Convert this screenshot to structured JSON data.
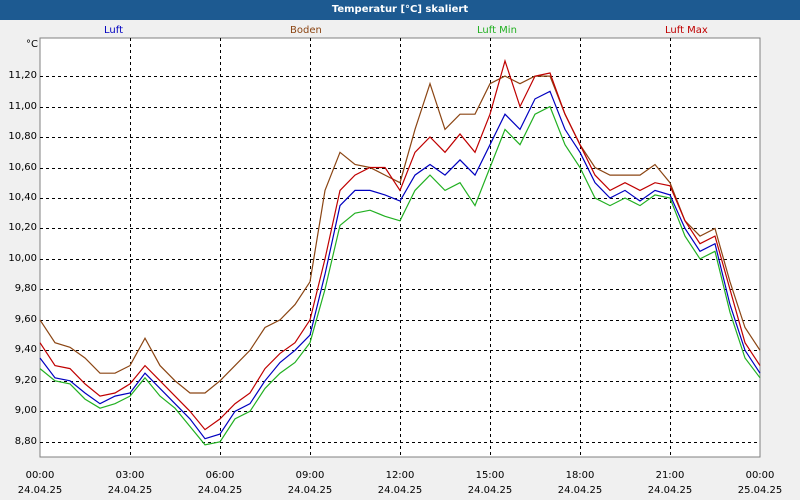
{
  "window": {
    "title": "Temperatur [°C] skaliert"
  },
  "colors": {
    "titlebar": "#1d5a91",
    "plot_bg": "#ffffff",
    "grid": "#000000"
  },
  "chart_data": {
    "type": "line",
    "title": "Temperatur [°C] skaliert",
    "ylabel": "°C",
    "ylim": [
      8.7,
      11.45
    ],
    "xlim": [
      0,
      24
    ],
    "grid": true,
    "legend_position": "top",
    "y_ticks": [
      "8,80",
      "9,00",
      "9,20",
      "9,40",
      "9,60",
      "9,80",
      "10,00",
      "10,20",
      "10,40",
      "10,60",
      "10,80",
      "11,00",
      "11,20"
    ],
    "y_tick_values": [
      8.8,
      9.0,
      9.2,
      9.4,
      9.6,
      9.8,
      10.0,
      10.2,
      10.4,
      10.6,
      10.8,
      11.0,
      11.2
    ],
    "x_ticks": [
      {
        "time": "00:00",
        "date": "24.04.25",
        "hour": 0
      },
      {
        "time": "03:00",
        "date": "24.04.25",
        "hour": 3
      },
      {
        "time": "06:00",
        "date": "24.04.25",
        "hour": 6
      },
      {
        "time": "09:00",
        "date": "24.04.25",
        "hour": 9
      },
      {
        "time": "12:00",
        "date": "24.04.25",
        "hour": 12
      },
      {
        "time": "15:00",
        "date": "24.04.25",
        "hour": 15
      },
      {
        "time": "18:00",
        "date": "24.04.25",
        "hour": 18
      },
      {
        "time": "21:00",
        "date": "24.04.25",
        "hour": 21
      },
      {
        "time": "00:00",
        "date": "25.04.25",
        "hour": 24
      }
    ],
    "x": [
      0,
      0.5,
      1,
      1.5,
      2,
      2.5,
      3,
      3.5,
      4,
      4.5,
      5,
      5.5,
      6,
      6.5,
      7,
      7.5,
      8,
      8.5,
      9,
      9.5,
      10,
      10.5,
      11,
      11.5,
      12,
      12.5,
      13,
      13.5,
      14,
      14.5,
      15,
      15.5,
      16,
      16.5,
      17,
      17.5,
      18,
      18.5,
      19,
      19.5,
      20,
      20.5,
      21,
      21.5,
      22,
      22.5,
      23,
      23.5,
      24
    ],
    "series": [
      {
        "name": "Luft",
        "color": "#0000c0",
        "values": [
          9.35,
          9.22,
          9.2,
          9.12,
          9.05,
          9.1,
          9.12,
          9.25,
          9.15,
          9.05,
          8.95,
          8.82,
          8.85,
          9.0,
          9.05,
          9.2,
          9.32,
          9.4,
          9.5,
          9.9,
          10.35,
          10.45,
          10.45,
          10.42,
          10.38,
          10.55,
          10.62,
          10.55,
          10.65,
          10.55,
          10.75,
          10.95,
          10.85,
          11.05,
          11.1,
          10.85,
          10.7,
          10.5,
          10.4,
          10.45,
          10.38,
          10.45,
          10.42,
          10.2,
          10.05,
          10.1,
          9.7,
          9.4,
          9.25
        ]
      },
      {
        "name": "Boden",
        "color": "#8b4513",
        "values": [
          9.6,
          9.45,
          9.42,
          9.35,
          9.25,
          9.25,
          9.3,
          9.48,
          9.3,
          9.2,
          9.12,
          9.12,
          9.2,
          9.3,
          9.4,
          9.55,
          9.6,
          9.7,
          9.85,
          10.45,
          10.7,
          10.62,
          10.6,
          10.55,
          10.5,
          10.85,
          11.15,
          10.85,
          10.95,
          10.95,
          11.15,
          11.2,
          11.15,
          11.2,
          11.2,
          10.95,
          10.75,
          10.6,
          10.55,
          10.55,
          10.55,
          10.62,
          10.5,
          10.25,
          10.15,
          10.2,
          9.85,
          9.55,
          9.4
        ]
      },
      {
        "name": "Luft Min",
        "color": "#22b022",
        "values": [
          9.28,
          9.2,
          9.18,
          9.08,
          9.02,
          9.05,
          9.1,
          9.22,
          9.1,
          9.02,
          8.9,
          8.78,
          8.8,
          8.95,
          9.0,
          9.15,
          9.25,
          9.32,
          9.45,
          9.8,
          10.22,
          10.3,
          10.32,
          10.28,
          10.25,
          10.45,
          10.55,
          10.45,
          10.5,
          10.35,
          10.6,
          10.85,
          10.75,
          10.95,
          11.0,
          10.75,
          10.6,
          10.4,
          10.35,
          10.4,
          10.35,
          10.42,
          10.4,
          10.15,
          10.0,
          10.05,
          9.65,
          9.35,
          9.22
        ]
      },
      {
        "name": "Luft Max",
        "color": "#c00000",
        "values": [
          9.45,
          9.3,
          9.28,
          9.18,
          9.1,
          9.12,
          9.18,
          9.3,
          9.2,
          9.1,
          9.0,
          8.88,
          8.95,
          9.05,
          9.12,
          9.28,
          9.38,
          9.45,
          9.6,
          10.0,
          10.45,
          10.55,
          10.6,
          10.6,
          10.45,
          10.7,
          10.8,
          10.7,
          10.82,
          10.7,
          10.95,
          11.3,
          11.0,
          11.2,
          11.22,
          10.95,
          10.75,
          10.55,
          10.45,
          10.5,
          10.45,
          10.5,
          10.48,
          10.25,
          10.1,
          10.15,
          9.8,
          9.45,
          9.3
        ]
      }
    ]
  }
}
